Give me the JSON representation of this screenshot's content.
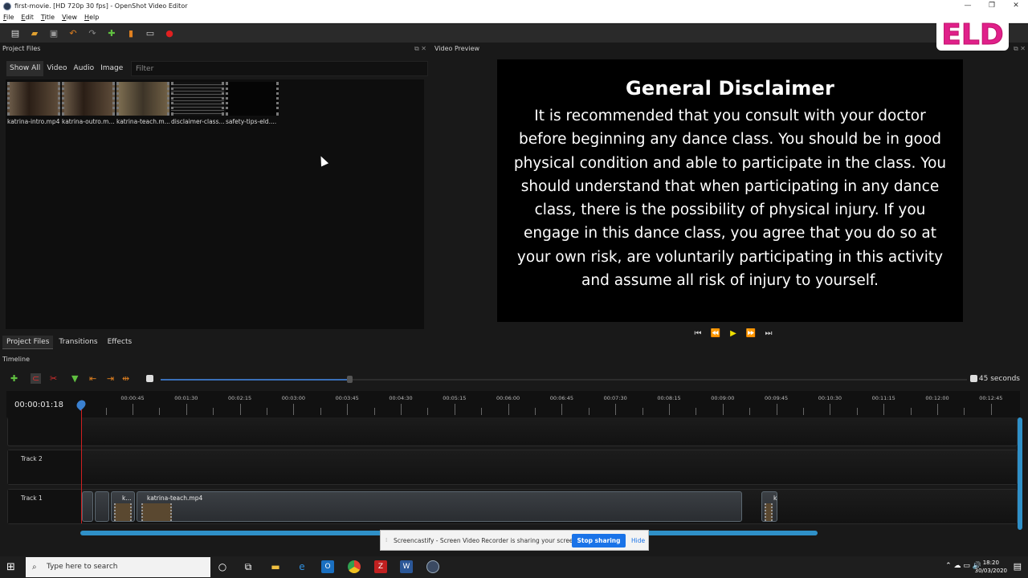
{
  "window": {
    "title": "first-movie. [HD 720p 30 fps] - OpenShot Video Editor",
    "controls": [
      "—",
      "❐",
      "✕"
    ]
  },
  "menu": [
    "File",
    "Edit",
    "Title",
    "View",
    "Help"
  ],
  "logo": {
    "text": "ELD"
  },
  "panels": {
    "project_files": "Project Files",
    "video_preview": "Video Preview",
    "timeline": "Timeline"
  },
  "filter_tabs": [
    "Show All",
    "Video",
    "Audio",
    "Image"
  ],
  "filter_placeholder": "Filter",
  "files": [
    {
      "name": "katrina-intro.mp4"
    },
    {
      "name": "katrina-outro.m..."
    },
    {
      "name": "katrina-teach.m..."
    },
    {
      "name": "disclaimer-class..."
    },
    {
      "name": "safety-tips-eld...."
    }
  ],
  "preview": {
    "heading": "General Disclaimer",
    "body": "It is recommended that you consult with your doctor before beginning any dance class. You should be in good physical condition and able to participate in the class. You should understand that when participating in any dance class, there is the possibility of physical injury. If you engage in this dance class, you agree that you do so at your own risk, are voluntarily participating in this activity and assume all risk of injury to yourself."
  },
  "bottom_tabs": [
    "Project Files",
    "Transitions",
    "Effects"
  ],
  "timeline": {
    "zoom_label": "45 seconds",
    "current_time": "00:00:01:18",
    "ticks": [
      "00:00:45",
      "00:01:30",
      "00:02:15",
      "00:03:00",
      "00:03:45",
      "00:04:30",
      "00:05:15",
      "00:06:00",
      "00:06:45",
      "00:07:30",
      "00:08:15",
      "00:09:00",
      "00:09:45",
      "00:10:30",
      "00:11:15",
      "00:12:00",
      "00:12:45"
    ],
    "tracks": [
      "Track 2",
      "Track 1"
    ],
    "clips": {
      "small": "k...",
      "main": "katrina-teach.mp4",
      "end": "k"
    }
  },
  "screencastify": {
    "message": "Screencastify - Screen Video Recorder is sharing your screen.",
    "stop": "Stop sharing",
    "hide": "Hide"
  },
  "taskbar": {
    "search": "Type here to search",
    "time": "18:20",
    "date": "30/03/2020"
  },
  "colors": {
    "accent": "#2f90c8",
    "playhead": "#d02020",
    "play_button": "#f0e000",
    "stop_button": "#1a73e8"
  }
}
